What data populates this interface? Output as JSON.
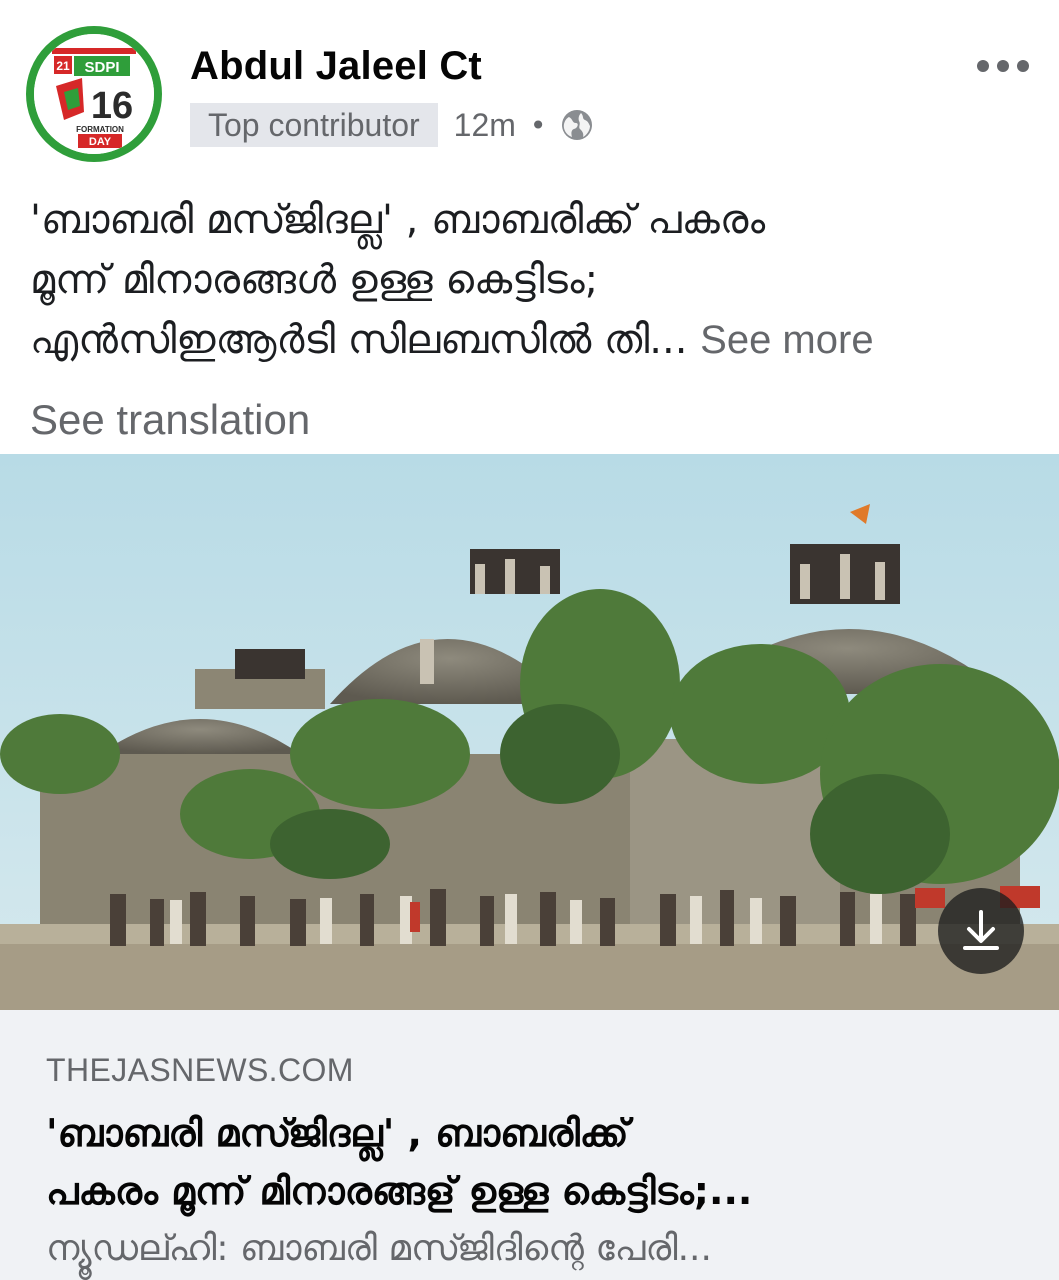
{
  "post": {
    "author": "Abdul Jaleel Ct",
    "badge": "Top contributor",
    "time": "12m",
    "separator": "•",
    "privacy_icon": "globe-icon",
    "more_icon": "more-horizontal-icon",
    "avatar": {
      "label": "SDPI 16 FORMATION DAY",
      "top_text": "SDPI",
      "number": "16",
      "date": "21",
      "bottom_text": "FORMATION",
      "bottom_text2": "DAY"
    },
    "text_lines": [
      "'ബാബരി മസ്ജിദല്ല' , ബാബരിക്ക് പകരം",
      "മൂന്ന് മിനാരങ്ങൾ ഉള്ള കെട്ടിടം;",
      "എന്‍സിഇആര്‍ടി സിലബസിൽ തി..."
    ],
    "see_more": "See more",
    "see_translation": "See translation"
  },
  "photo": {
    "download_icon": "download-icon"
  },
  "link_card": {
    "domain": "THEJASNEWS.COM",
    "title_lines": [
      "'ബാബരി മസ്ജിദല്ല' , ബാബരിക്ക്",
      "പകരം മൂന്ന് മിനാരങ്ങള് ഉള്ള കെട്ടിടം;..."
    ],
    "description": "ന്യൂഡല്ഹി: ബാബരി മസ്ജിദിന്റെ പേരി..."
  },
  "colors": {
    "secondary_text": "#65676b",
    "badge_bg": "#e4e6eb",
    "card_bg": "#f0f2f5",
    "avatar_ring": "#2f9e3a"
  }
}
